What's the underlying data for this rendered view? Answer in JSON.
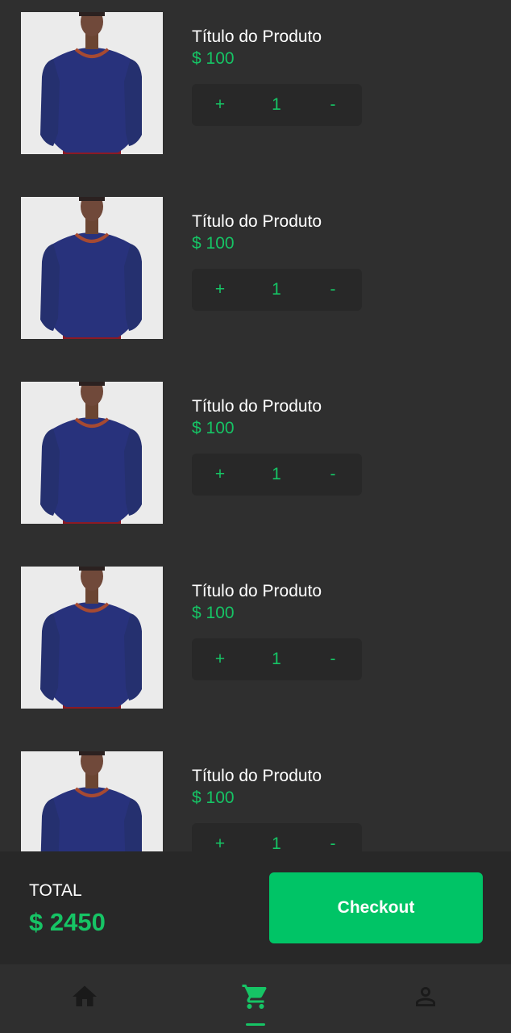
{
  "colors": {
    "background": "#2f2f2f",
    "panel": "#282828",
    "accent": "#16c465",
    "checkout": "#00c466",
    "text": "#ffffff",
    "icon_inactive": "#1a1a1a"
  },
  "cart": {
    "items": [
      {
        "title": "Título do Produto",
        "price": "$ 100",
        "quantity": "1",
        "plus_label": "+",
        "minus_label": "-",
        "image_icon": "product-photo-sweater"
      },
      {
        "title": "Título do Produto",
        "price": "$ 100",
        "quantity": "1",
        "plus_label": "+",
        "minus_label": "-",
        "image_icon": "product-photo-sweater"
      },
      {
        "title": "Título do Produto",
        "price": "$ 100",
        "quantity": "1",
        "plus_label": "+",
        "minus_label": "-",
        "image_icon": "product-photo-sweater"
      },
      {
        "title": "Título do Produto",
        "price": "$ 100",
        "quantity": "1",
        "plus_label": "+",
        "minus_label": "-",
        "image_icon": "product-photo-sweater"
      },
      {
        "title": "Título do Produto",
        "price": "$ 100",
        "quantity": "1",
        "plus_label": "+",
        "minus_label": "-",
        "image_icon": "product-photo-sweater"
      }
    ]
  },
  "footer": {
    "total_label": "TOTAL",
    "total_value": "$ 2450",
    "checkout_label": "Checkout"
  },
  "nav": {
    "items": [
      {
        "icon": "home-icon",
        "active": false
      },
      {
        "icon": "cart-icon",
        "active": true
      },
      {
        "icon": "profile-icon",
        "active": false
      }
    ]
  }
}
